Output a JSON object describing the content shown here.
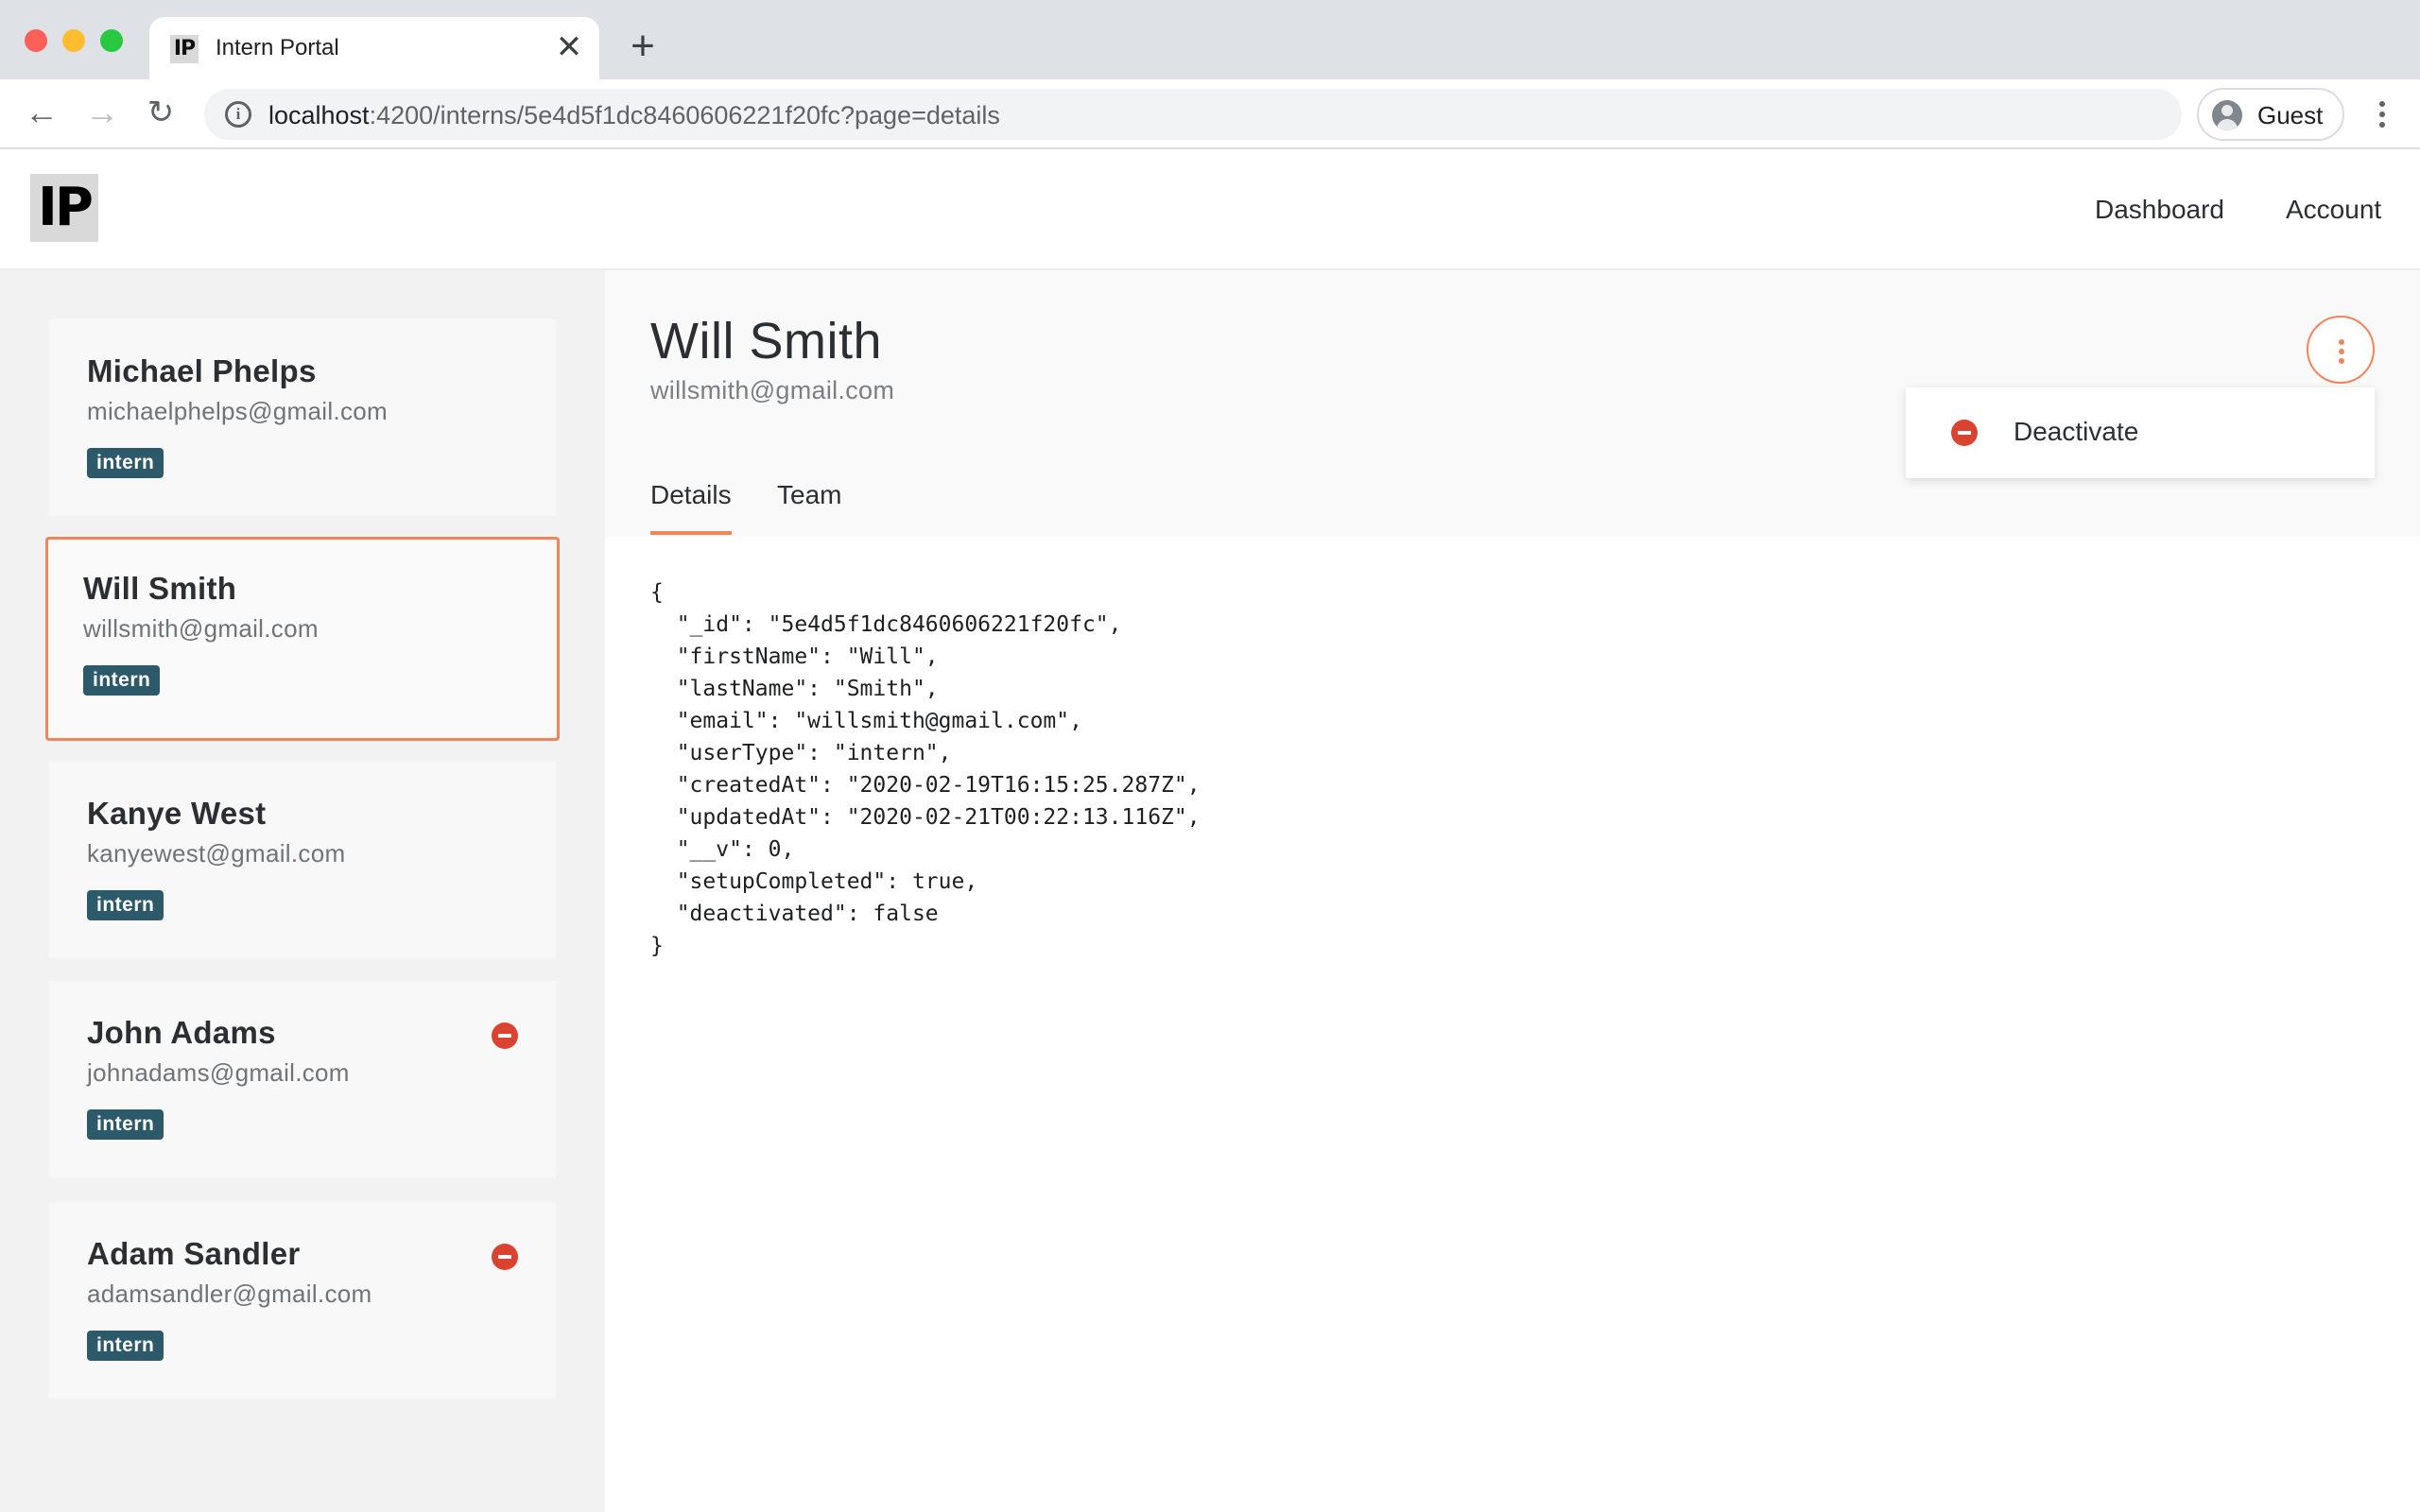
{
  "browser": {
    "tab_favicon": "IP",
    "tab_title": "Intern Portal",
    "tab_close": "✕",
    "new_tab": "+",
    "back": "←",
    "forward": "→",
    "reload": "↻",
    "info_icon": "i",
    "url_host": "localhost",
    "url_rest": ":4200/interns/5e4d5f1dc8460606221f20fc?page=details",
    "profile_label": "Guest"
  },
  "app": {
    "logo": "IP",
    "nav": {
      "dashboard": "Dashboard",
      "account": "Account"
    }
  },
  "sidebar": {
    "cards": [
      {
        "name": "Michael Phelps",
        "email": "michaelphelps@gmail.com",
        "tag": "intern",
        "deactivated": false
      },
      {
        "name": "Will Smith",
        "email": "willsmith@gmail.com",
        "tag": "intern",
        "deactivated": false,
        "selected": true
      },
      {
        "name": "Kanye West",
        "email": "kanyewest@gmail.com",
        "tag": "intern",
        "deactivated": false
      },
      {
        "name": "John Adams",
        "email": "johnadams@gmail.com",
        "tag": "intern",
        "deactivated": true
      },
      {
        "name": "Adam Sandler",
        "email": "adamsandler@gmail.com",
        "tag": "intern",
        "deactivated": true
      }
    ]
  },
  "detail": {
    "name": "Will Smith",
    "email": "willsmith@gmail.com",
    "tabs": {
      "details": "Details",
      "team": "Team"
    },
    "active_tab": "Details",
    "menu": {
      "deactivate": "Deactivate"
    },
    "json_lines": [
      "{",
      "  \"_id\": \"5e4d5f1dc8460606221f20fc\",",
      "  \"firstName\": \"Will\",",
      "  \"lastName\": \"Smith\",",
      "  \"email\": \"willsmith@gmail.com\",",
      "  \"userType\": \"intern\",",
      "  \"createdAt\": \"2020-02-19T16:15:25.287Z\",",
      "  \"updatedAt\": \"2020-02-21T00:22:13.116Z\",",
      "  \"__v\": 0,",
      "  \"setupCompleted\": true,",
      "  \"deactivated\": false",
      "}"
    ]
  },
  "colors": {
    "accent": "#f0845a",
    "tag_bg": "#2d5a6b",
    "deactivate_icon": "#d9432f"
  },
  "icons": {
    "tab_favicon": "ip-logo-icon",
    "info": "info-icon",
    "profile": "guest-avatar-icon",
    "browser_menu": "three-dots-vertical-icon",
    "kebab": "kebab-menu-icon",
    "deactivate": "minus-circle-icon"
  }
}
